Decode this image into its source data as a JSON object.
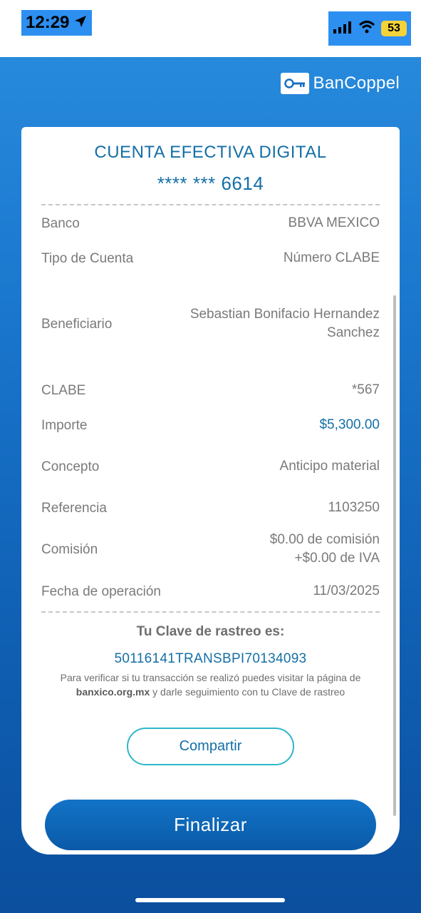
{
  "status_bar": {
    "time": "12:29",
    "battery": "53",
    "location_icon": "location-arrow-icon",
    "signal_icon": "cellular-signal-icon",
    "wifi_icon": "wifi-icon"
  },
  "brand": {
    "name": "BanCoppel",
    "key_icon": "key-icon"
  },
  "card": {
    "title": "CUENTA EFECTIVA DIGITAL",
    "account_masked": "**** *** 6614",
    "rows": [
      {
        "label": "Banco",
        "value": "BBVA MEXICO"
      },
      {
        "label": "Tipo de Cuenta",
        "value": "Número CLABE"
      },
      {
        "label": "Beneficiario",
        "value_line1": "Sebastian Bonifacio Hernandez",
        "value_line2": "Sanchez"
      },
      {
        "label": "CLABE",
        "value": "*567"
      },
      {
        "label": "Importe",
        "value": "$5,300.00"
      },
      {
        "label": "Concepto",
        "value": "Anticipo material"
      },
      {
        "label": "Referencia",
        "value": "1103250"
      },
      {
        "label": "Comisión",
        "value_line1": "$0.00 de comisión",
        "value_line2": "+$0.00 de IVA"
      },
      {
        "label": "Fecha de operación",
        "value": "11/03/2025"
      }
    ],
    "tracking_title": "Tu Clave de rastreo es:",
    "tracking_code": "50116141TRANSBPI70134093",
    "verify_text_1": "Para verificar si tu transacción se realizó puedes visitar la página de",
    "verify_link": "banxico.org.mx",
    "verify_text_2": " y darle seguimiento con tu Clave de rastreo"
  },
  "buttons": {
    "share_label": "Compartir",
    "finish_label": "Finalizar"
  },
  "colors": {
    "accent": "#146fa6",
    "button_blue": "#0f67b8",
    "share_border": "#2fb6c9"
  }
}
